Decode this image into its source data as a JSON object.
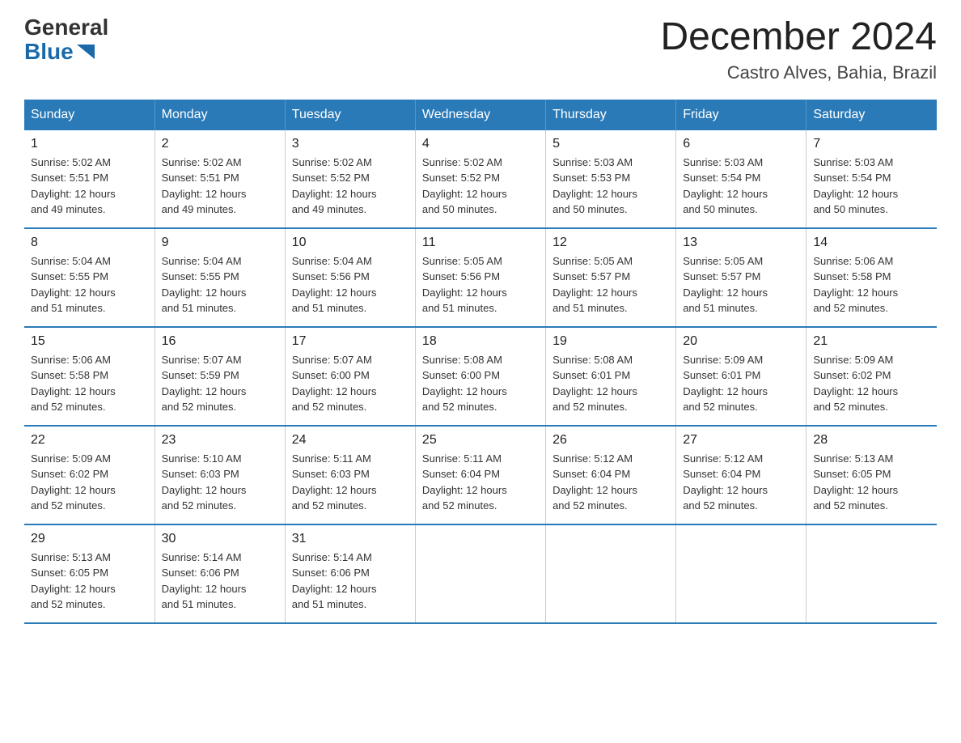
{
  "logo": {
    "general": "General",
    "blue": "Blue"
  },
  "title": "December 2024",
  "location": "Castro Alves, Bahia, Brazil",
  "days_of_week": [
    "Sunday",
    "Monday",
    "Tuesday",
    "Wednesday",
    "Thursday",
    "Friday",
    "Saturday"
  ],
  "weeks": [
    [
      {
        "day": "1",
        "sunrise": "5:02 AM",
        "sunset": "5:51 PM",
        "daylight": "12 hours and 49 minutes."
      },
      {
        "day": "2",
        "sunrise": "5:02 AM",
        "sunset": "5:51 PM",
        "daylight": "12 hours and 49 minutes."
      },
      {
        "day": "3",
        "sunrise": "5:02 AM",
        "sunset": "5:52 PM",
        "daylight": "12 hours and 49 minutes."
      },
      {
        "day": "4",
        "sunrise": "5:02 AM",
        "sunset": "5:52 PM",
        "daylight": "12 hours and 50 minutes."
      },
      {
        "day": "5",
        "sunrise": "5:03 AM",
        "sunset": "5:53 PM",
        "daylight": "12 hours and 50 minutes."
      },
      {
        "day": "6",
        "sunrise": "5:03 AM",
        "sunset": "5:54 PM",
        "daylight": "12 hours and 50 minutes."
      },
      {
        "day": "7",
        "sunrise": "5:03 AM",
        "sunset": "5:54 PM",
        "daylight": "12 hours and 50 minutes."
      }
    ],
    [
      {
        "day": "8",
        "sunrise": "5:04 AM",
        "sunset": "5:55 PM",
        "daylight": "12 hours and 51 minutes."
      },
      {
        "day": "9",
        "sunrise": "5:04 AM",
        "sunset": "5:55 PM",
        "daylight": "12 hours and 51 minutes."
      },
      {
        "day": "10",
        "sunrise": "5:04 AM",
        "sunset": "5:56 PM",
        "daylight": "12 hours and 51 minutes."
      },
      {
        "day": "11",
        "sunrise": "5:05 AM",
        "sunset": "5:56 PM",
        "daylight": "12 hours and 51 minutes."
      },
      {
        "day": "12",
        "sunrise": "5:05 AM",
        "sunset": "5:57 PM",
        "daylight": "12 hours and 51 minutes."
      },
      {
        "day": "13",
        "sunrise": "5:05 AM",
        "sunset": "5:57 PM",
        "daylight": "12 hours and 51 minutes."
      },
      {
        "day": "14",
        "sunrise": "5:06 AM",
        "sunset": "5:58 PM",
        "daylight": "12 hours and 52 minutes."
      }
    ],
    [
      {
        "day": "15",
        "sunrise": "5:06 AM",
        "sunset": "5:58 PM",
        "daylight": "12 hours and 52 minutes."
      },
      {
        "day": "16",
        "sunrise": "5:07 AM",
        "sunset": "5:59 PM",
        "daylight": "12 hours and 52 minutes."
      },
      {
        "day": "17",
        "sunrise": "5:07 AM",
        "sunset": "6:00 PM",
        "daylight": "12 hours and 52 minutes."
      },
      {
        "day": "18",
        "sunrise": "5:08 AM",
        "sunset": "6:00 PM",
        "daylight": "12 hours and 52 minutes."
      },
      {
        "day": "19",
        "sunrise": "5:08 AM",
        "sunset": "6:01 PM",
        "daylight": "12 hours and 52 minutes."
      },
      {
        "day": "20",
        "sunrise": "5:09 AM",
        "sunset": "6:01 PM",
        "daylight": "12 hours and 52 minutes."
      },
      {
        "day": "21",
        "sunrise": "5:09 AM",
        "sunset": "6:02 PM",
        "daylight": "12 hours and 52 minutes."
      }
    ],
    [
      {
        "day": "22",
        "sunrise": "5:09 AM",
        "sunset": "6:02 PM",
        "daylight": "12 hours and 52 minutes."
      },
      {
        "day": "23",
        "sunrise": "5:10 AM",
        "sunset": "6:03 PM",
        "daylight": "12 hours and 52 minutes."
      },
      {
        "day": "24",
        "sunrise": "5:11 AM",
        "sunset": "6:03 PM",
        "daylight": "12 hours and 52 minutes."
      },
      {
        "day": "25",
        "sunrise": "5:11 AM",
        "sunset": "6:04 PM",
        "daylight": "12 hours and 52 minutes."
      },
      {
        "day": "26",
        "sunrise": "5:12 AM",
        "sunset": "6:04 PM",
        "daylight": "12 hours and 52 minutes."
      },
      {
        "day": "27",
        "sunrise": "5:12 AM",
        "sunset": "6:04 PM",
        "daylight": "12 hours and 52 minutes."
      },
      {
        "day": "28",
        "sunrise": "5:13 AM",
        "sunset": "6:05 PM",
        "daylight": "12 hours and 52 minutes."
      }
    ],
    [
      {
        "day": "29",
        "sunrise": "5:13 AM",
        "sunset": "6:05 PM",
        "daylight": "12 hours and 52 minutes."
      },
      {
        "day": "30",
        "sunrise": "5:14 AM",
        "sunset": "6:06 PM",
        "daylight": "12 hours and 51 minutes."
      },
      {
        "day": "31",
        "sunrise": "5:14 AM",
        "sunset": "6:06 PM",
        "daylight": "12 hours and 51 minutes."
      },
      null,
      null,
      null,
      null
    ]
  ],
  "labels": {
    "sunrise": "Sunrise:",
    "sunset": "Sunset:",
    "daylight": "Daylight:"
  }
}
